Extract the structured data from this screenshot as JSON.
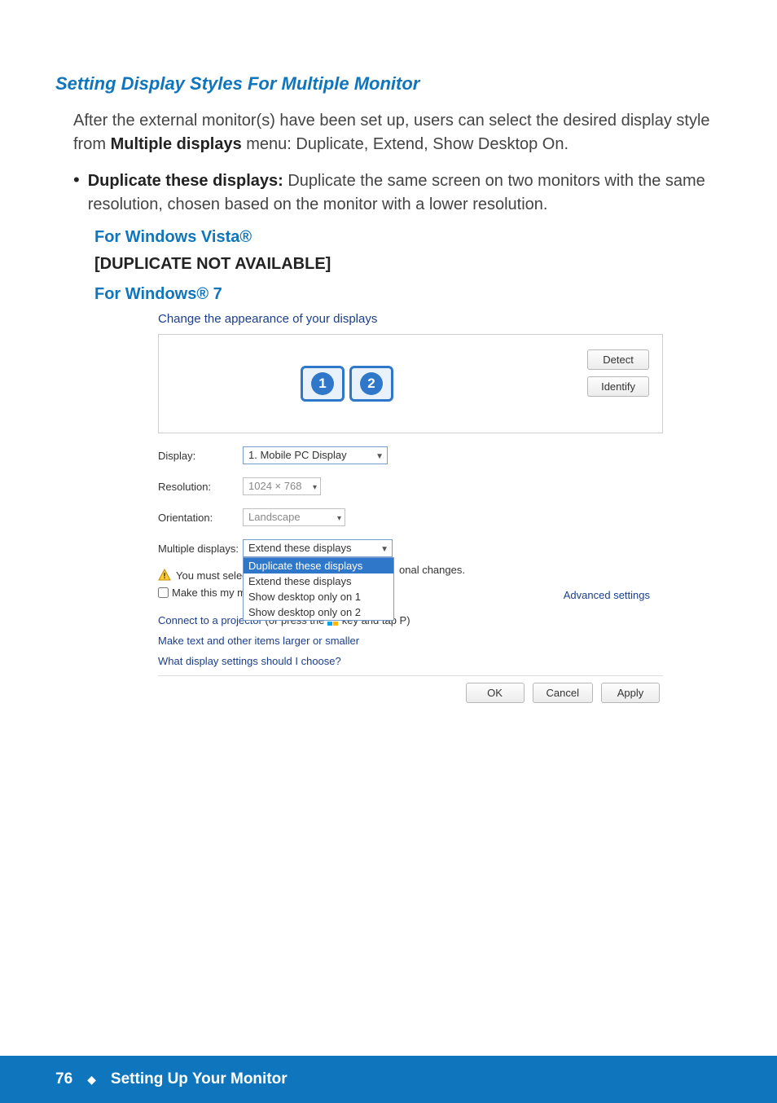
{
  "doc": {
    "section_title": "Setting Display Styles For Multiple Monitor",
    "intro_before": "After the external monitor(s) have been set up, users can select the desired display style from ",
    "intro_bold": "Multiple displays",
    "intro_after": " menu:  Duplicate, Extend, Show Desktop On.",
    "bullet_bold": "Duplicate these displays:",
    "bullet_text": " Duplicate the same screen on two monitors with the same resolution, chosen based on the monitor with a lower resolution.",
    "vista_heading": "For Windows Vista®",
    "vista_note": "[DUPLICATE NOT AVAILABLE]",
    "win7_heading": "For Windows® 7"
  },
  "screenshot": {
    "title": "Change the appearance of your displays",
    "monitor1": "1",
    "monitor2": "2",
    "detect": "Detect",
    "identify": "Identify",
    "labels": {
      "display": "Display:",
      "resolution": "Resolution:",
      "orientation": "Orientation:",
      "multiple": "Multiple displays:"
    },
    "values": {
      "display": "1. Mobile PC Display",
      "resolution": "1024 × 768",
      "orientation": "Landscape",
      "multiple": "Extend these displays"
    },
    "dropdown": {
      "opt1": "Duplicate these displays",
      "opt2": "Extend these displays",
      "opt3": "Show desktop only on 1",
      "opt4": "Show desktop only on 2"
    },
    "warn_left": "You must select",
    "warn_right": "onal changes.",
    "checkbox_left": "Make this my ma",
    "adv": "Advanced settings",
    "links": {
      "projector_link": "Connect to a projector",
      "projector_plain": " (or press the ",
      "projector_tail": " key and tap P)",
      "textsize": "Make text and other items larger or smaller",
      "which": "What display settings should I choose?"
    },
    "buttons": {
      "ok": "OK",
      "cancel": "Cancel",
      "apply": "Apply"
    }
  },
  "footer": {
    "page": "76",
    "diamond": "◆",
    "title": "Setting Up Your Monitor"
  }
}
